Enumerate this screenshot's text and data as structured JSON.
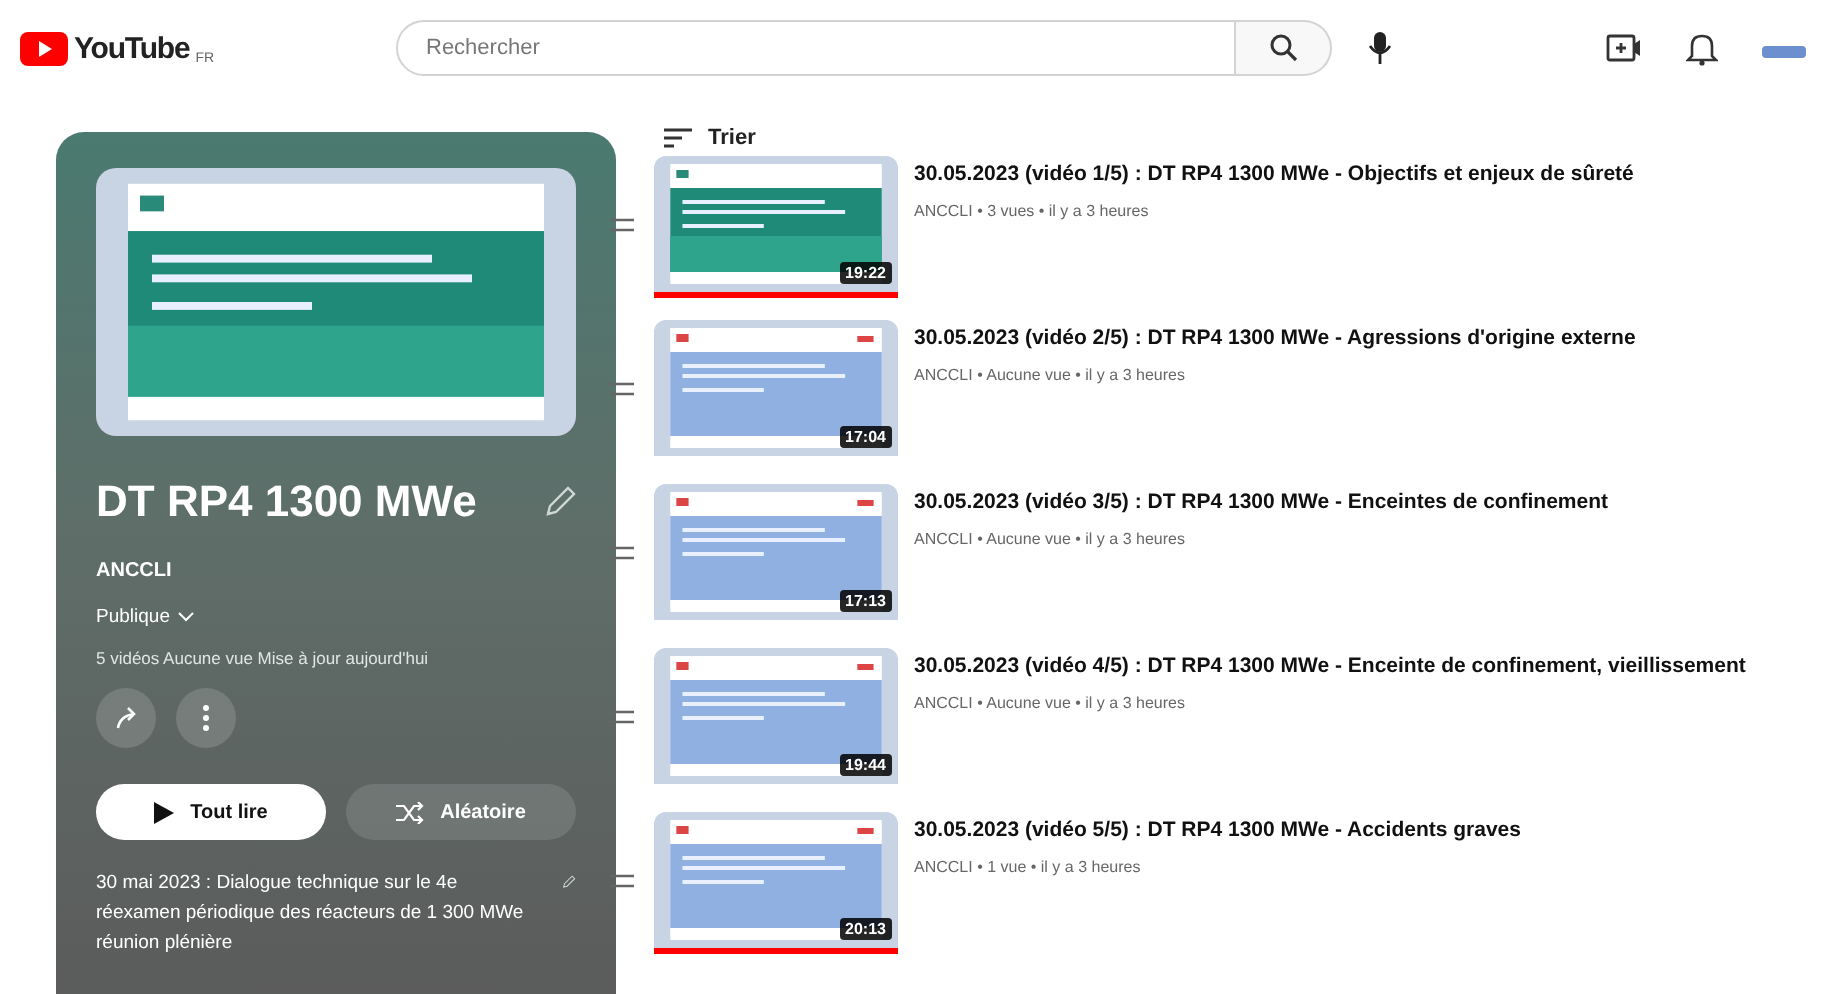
{
  "header": {
    "logo": "YouTube",
    "country": "FR",
    "search": {
      "placeholder": "Rechercher"
    }
  },
  "playlist": {
    "title": "DT RP4 1300 MWe",
    "owner": "ANCCLI",
    "visibility": "Publique",
    "stats": "5 vidéos  Aucune vue  Mise à jour aujourd'hui",
    "play_all": "Tout lire",
    "shuffle": "Aléatoire",
    "description": "30 mai 2023 : Dialogue technique sur le 4e réexamen périodique des réacteurs de 1 300 MWe réunion plénière"
  },
  "sort": "Trier",
  "videos": [
    {
      "title": "30.05.2023 (vidéo 1/5) : DT RP4 1300 MWe - Objectifs et enjeux de sûreté",
      "meta": "ANCCLI • 3 vues • il y a 3 heures",
      "duration": "19:22",
      "watched": true
    },
    {
      "title": "30.05.2023 (vidéo 2/5) : DT RP4 1300 MWe - Agressions d'origine externe",
      "meta": "ANCCLI • Aucune vue • il y a 3 heures",
      "duration": "17:04",
      "watched": false
    },
    {
      "title": "30.05.2023 (vidéo 3/5) : DT RP4 1300 MWe - Enceintes de confinement",
      "meta": "ANCCLI • Aucune vue • il y a 3 heures",
      "duration": "17:13",
      "watched": false
    },
    {
      "title": "30.05.2023 (vidéo 4/5) : DT RP4 1300 MWe - Enceinte de confinement, vieillissement",
      "meta": "ANCCLI • Aucune vue • il y a 3 heures",
      "duration": "19:44",
      "watched": false
    },
    {
      "title": "30.05.2023 (vidéo 5/5) : DT RP4 1300 MWe - Accidents graves",
      "meta": "ANCCLI • 1 vue • il y a 3 heures",
      "duration": "20:13",
      "watched": true
    }
  ]
}
